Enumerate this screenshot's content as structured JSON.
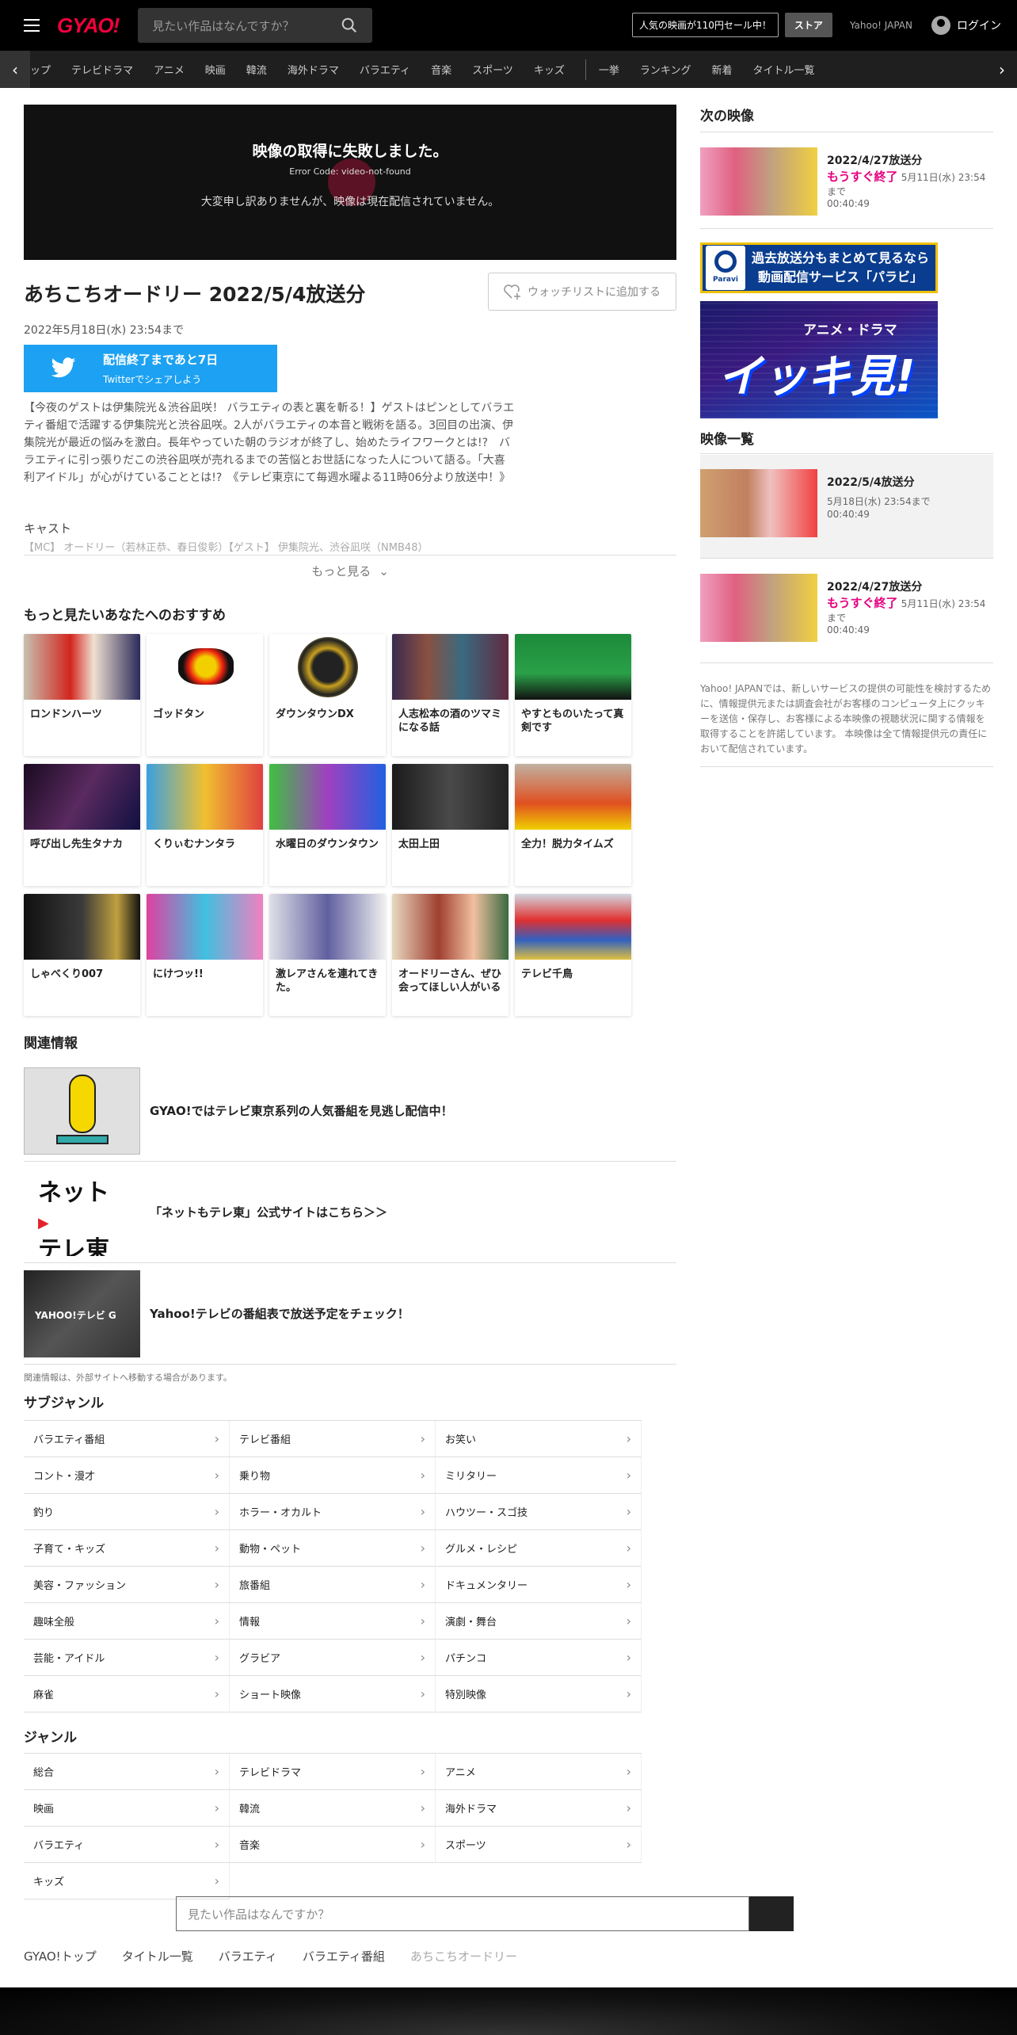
{
  "header": {
    "logo": "GYAO!",
    "search_placeholder": "見たい作品はなんですか？",
    "promo": "人気の映画が110円セール中！",
    "store": "ストア",
    "yahoo": "Yahoo! JAPAN",
    "login": "ログイン"
  },
  "nav": {
    "items": [
      "ップ",
      "テレビドラマ",
      "アニメ",
      "映画",
      "韓流",
      "海外ドラマ",
      "バラエティ",
      "音楽",
      "スポーツ",
      "キッズ"
    ],
    "items2": [
      "一挙",
      "ランキング",
      "新着",
      "タイトル一覧"
    ]
  },
  "player": {
    "title": "映像の取得に失敗しました。",
    "error": "Error Code: video-not-found",
    "message": "大変申し訳ありませんが、映像は現在配信されていません。"
  },
  "program": {
    "title": "あちこちオードリー 2022/5/4放送分",
    "watchlist": "ウォッチリストに追加する",
    "date": "2022年5月18日(水) 23:54まで",
    "twitter_main": "配信終了まであと7日",
    "twitter_sub": "Twitterでシェアしよう",
    "description": "【今夜のゲストは伊集院光＆渋谷凪咲！ バラエティの表と裏を斬る！】ゲストはピンとしてバラエティ番組で活躍する伊集院光と渋谷凪咲。2人がバラエティの本音と戦術を語る。3回目の出演、伊集院光が最近の悩みを激白。長年やっていた朝のラジオが終了し、始めたライフワークとは!?　バラエティに引っ張りだこの渋谷凪咲が売れるまでの苦悩とお世話になった人について語る。「大喜利アイドル」が心がけていることとは!?　《テレビ東京にて毎週水曜よる11時06分より放送中！》",
    "cast_heading": "キャスト",
    "cast": "【MC】 オードリー（若林正恭、春日俊彰）【ゲスト】 伊集院光、渋谷凪咲（NMB48）",
    "more": "もっと見る"
  },
  "recommend": {
    "heading": "もっと見たいあなたへのおすすめ",
    "items": [
      "ロンドンハーツ",
      "ゴッドタン",
      "ダウンタウンDX",
      "人志松本の酒のツマミになる話",
      "やすとものいたって真剣です",
      "呼び出し先生タナカ",
      "くりぃむナンタラ",
      "水曜日のダウンタウン",
      "太田上田",
      "全力！脱力タイムズ",
      "しゃべくり007",
      "にけつッ!!",
      "激レアさんを連れてきた。",
      "オードリーさん、ぜひ会ってほしい人がいる",
      "テレビ千鳥"
    ]
  },
  "related": {
    "heading": "関連情報",
    "items": [
      "GYAO!ではテレビ東京系列の人気番組を見逃し配信中！",
      "「ネットもテレ東」公式サイトはこちら＞＞",
      "Yahoo!テレビの番組表で放送予定をチェック！"
    ],
    "note": "関連情報は、外部サイトへ移動する場合があります。"
  },
  "subgenre": {
    "heading": "サブジャンル",
    "items": [
      "バラエティ番組",
      "テレビ番組",
      "お笑い",
      "コント・漫才",
      "乗り物",
      "ミリタリー",
      "釣り",
      "ホラー・オカルト",
      "ハウツー・スゴ技",
      "子育て・キッズ",
      "動物・ペット",
      "グルメ・レシピ",
      "美容・ファッション",
      "旅番組",
      "ドキュメンタリー",
      "趣味全般",
      "情報",
      "演劇・舞台",
      "芸能・アイドル",
      "グラビア",
      "パチンコ",
      "麻雀",
      "ショート映像",
      "特別映像"
    ]
  },
  "genre": {
    "heading": "ジャンル",
    "items": [
      "総合",
      "テレビドラマ",
      "アニメ",
      "映画",
      "韓流",
      "海外ドラマ",
      "バラエティ",
      "音楽",
      "スポーツ",
      "キッズ"
    ]
  },
  "bottom_search": {
    "placeholder": "見たい作品はなんですか？"
  },
  "breadcrumb": [
    "GYAO!トップ",
    "タイトル一覧",
    "バラエティ",
    "バラエティ番組",
    "あちこちオードリー"
  ],
  "sidebar": {
    "next_heading": "次の映像",
    "next": {
      "date": "2022/4/27放送分",
      "status": "もうすぐ終了",
      "until": "5月11日(水) 23:54",
      "until2": "まで",
      "duration": "00:40:49"
    },
    "ad1_line1": "過去放送分もまとめて見るなら",
    "ad1_line2": "動画配信サービス「パラビ」",
    "ad1_logo": "Paravi",
    "ad2_small": "アニメ・ドラマ",
    "ad2_big": "イッキ見!",
    "list_heading": "映像一覧",
    "list": [
      {
        "date": "2022/5/4放送分",
        "until": "5月18日(水) 23:54まで",
        "duration": "00:40:49"
      },
      {
        "date": "2022/4/27放送分",
        "status": "もうすぐ終了",
        "until": "5月11日(水) 23:54",
        "until2": "まで",
        "duration": "00:40:49"
      }
    ],
    "note": "Yahoo! JAPANでは、新しいサービスの提供の可能性を検討するために、情報提供元または調査会社がお客様のコンピュータ上にクッキーを送信・保存し、お客様による本映像の視聴状況に関する情報を取得することを許諾しています。 本映像は全て情報提供元の責任において配信されています。"
  },
  "colors": {
    "accent": "#f2003c",
    "twitter": "#1da1f2",
    "status": "#e4007f"
  }
}
